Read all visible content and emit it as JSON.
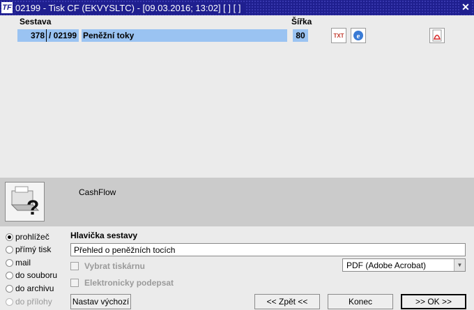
{
  "window": {
    "title": "02199 - Tisk CF (EKVYSLTC) - [09.03.2016; 13:02]  [ ]  [ ]",
    "app_icon_text": "TF",
    "close_glyph": "✕"
  },
  "report_table": {
    "col_sestava": "Sestava",
    "col_sirka": "Šířka",
    "row": {
      "number": "378",
      "code": "/ 02199",
      "name": "Peněžní toky",
      "width": "80"
    }
  },
  "tools": {
    "txt_icon_label": "TXT"
  },
  "info": {
    "report_title": "CashFlow"
  },
  "output": {
    "options": [
      {
        "label": "prohlížeč",
        "selected": true,
        "enabled": true
      },
      {
        "label": "přímý tisk",
        "selected": false,
        "enabled": true
      },
      {
        "label": "mail",
        "selected": false,
        "enabled": true
      },
      {
        "label": "do souboru",
        "selected": false,
        "enabled": true
      },
      {
        "label": "do archivu",
        "selected": false,
        "enabled": true
      },
      {
        "label": "do přílohy",
        "selected": false,
        "enabled": false
      }
    ]
  },
  "header": {
    "label": "Hlavička sestavy",
    "value": "Přehled o peněžních tocích"
  },
  "printer": {
    "choose_label": "Vybrat tiskárnu",
    "sign_label": "Elektronicky podepsat",
    "selected": "PDF (Adobe Acrobat)"
  },
  "buttons": {
    "defaults": "Nastav výchozí",
    "back": "<< Zpět <<",
    "end": "Konec",
    "ok": ">> OK >>"
  },
  "colors": {
    "title_bar": "#1f1f8f",
    "selection": "#9ac3f2",
    "panel": "#ebebeb",
    "band": "#cbcbcb"
  }
}
